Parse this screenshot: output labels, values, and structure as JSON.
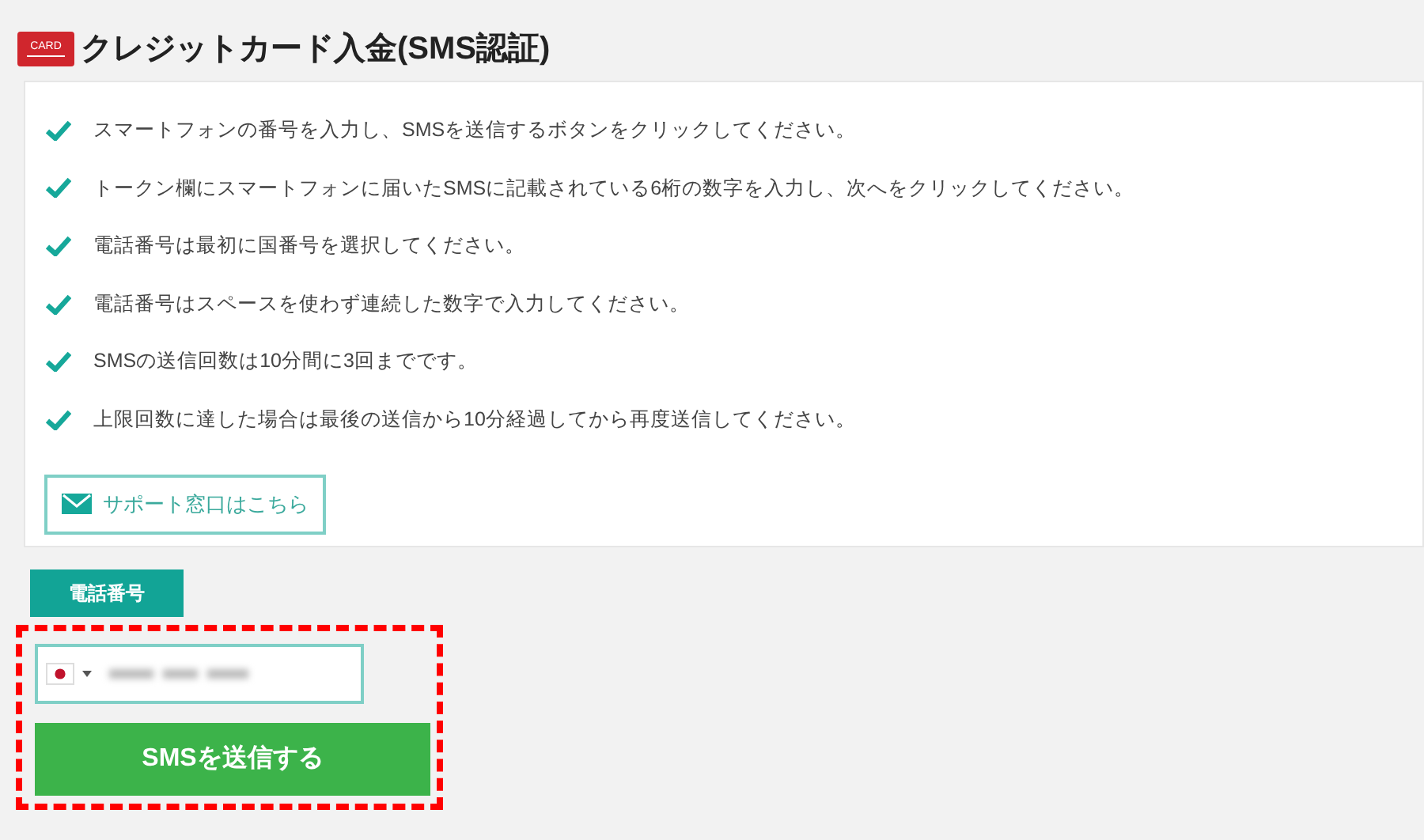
{
  "header": {
    "icon_text": "CARD",
    "title": "クレジットカード入金(SMS認証)"
  },
  "notes": [
    "スマートフォンの番号を入力し、SMSを送信するボタンをクリックしてください。",
    "トークン欄にスマートフォンに届いたSMSに記載されている6桁の数字を入力し、次へをクリックしてください。",
    "電話番号は最初に国番号を選択してください。",
    "電話番号はスペースを使わず連続した数字で入力してください。",
    "SMSの送信回数は10分間に3回までです。",
    "上限回数に達した場合は最後の送信から10分経過してから再度送信してください。"
  ],
  "support_button": "サポート窓口はこちら",
  "phone": {
    "label": "電話番号",
    "highlighted": true
  },
  "send_button": "SMSを送信する"
}
